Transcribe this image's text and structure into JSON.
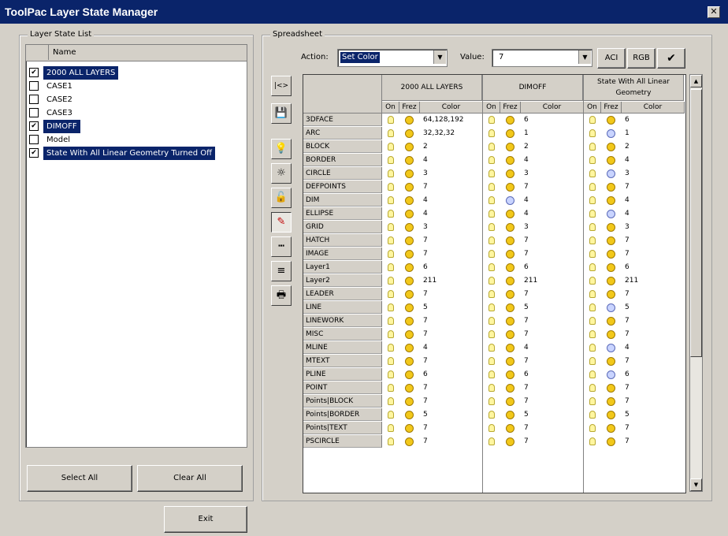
{
  "window": {
    "title": "ToolPac Layer State Manager",
    "close_glyph": "✕"
  },
  "layer_state_list": {
    "legend": "Layer State List",
    "header_name": "Name",
    "items": [
      {
        "label": "2000 ALL LAYERS",
        "checked": true,
        "selected": true
      },
      {
        "label": "CASE1",
        "checked": false,
        "selected": false
      },
      {
        "label": "CASE2",
        "checked": false,
        "selected": false
      },
      {
        "label": "CASE3",
        "checked": false,
        "selected": false
      },
      {
        "label": "DIMOFF",
        "checked": true,
        "selected": true
      },
      {
        "label": "Model",
        "checked": false,
        "selected": false
      },
      {
        "label": "State With All Linear Geometry Turned Off",
        "checked": true,
        "selected": true
      }
    ],
    "select_all_label": "Select All",
    "clear_all_label": "Clear All"
  },
  "spreadsheet": {
    "legend": "Spreadsheet",
    "action_label": "Action:",
    "action_value": "Set Color",
    "value_label": "Value:",
    "value_value": "7",
    "aci_label": "ACI",
    "rgb_label": "RGB",
    "apply_glyph": "✔",
    "states": [
      "2000 ALL LAYERS",
      "DIMOFF",
      "State With All Linear Geometry"
    ],
    "sub_headers": {
      "on": "On",
      "frz": "Frez",
      "color": "Color"
    },
    "rows": [
      {
        "name": "3DFACE",
        "c": [
          "64,128,192",
          "6",
          "6"
        ],
        "frz": [
          0,
          0,
          0
        ]
      },
      {
        "name": "ARC",
        "c": [
          "32,32,32",
          "1",
          "1"
        ],
        "frz": [
          0,
          0,
          1
        ]
      },
      {
        "name": "BLOCK",
        "c": [
          "2",
          "2",
          "2"
        ],
        "frz": [
          0,
          0,
          0
        ]
      },
      {
        "name": "BORDER",
        "c": [
          "4",
          "4",
          "4"
        ],
        "frz": [
          0,
          0,
          0
        ]
      },
      {
        "name": "CIRCLE",
        "c": [
          "3",
          "3",
          "3"
        ],
        "frz": [
          0,
          0,
          1
        ]
      },
      {
        "name": "DEFPOINTS",
        "c": [
          "7",
          "7",
          "7"
        ],
        "frz": [
          0,
          0,
          0
        ]
      },
      {
        "name": "DIM",
        "c": [
          "4",
          "4",
          "4"
        ],
        "frz": [
          0,
          1,
          0
        ]
      },
      {
        "name": "ELLIPSE",
        "c": [
          "4",
          "4",
          "4"
        ],
        "frz": [
          0,
          0,
          1
        ]
      },
      {
        "name": "GRID",
        "c": [
          "3",
          "3",
          "3"
        ],
        "frz": [
          0,
          0,
          0
        ]
      },
      {
        "name": "HATCH",
        "c": [
          "7",
          "7",
          "7"
        ],
        "frz": [
          0,
          0,
          0
        ]
      },
      {
        "name": "IMAGE",
        "c": [
          "7",
          "7",
          "7"
        ],
        "frz": [
          0,
          0,
          0
        ]
      },
      {
        "name": "Layer1",
        "c": [
          "6",
          "6",
          "6"
        ],
        "frz": [
          0,
          0,
          0
        ]
      },
      {
        "name": "Layer2",
        "c": [
          "211",
          "211",
          "211"
        ],
        "frz": [
          0,
          0,
          0
        ]
      },
      {
        "name": "LEADER",
        "c": [
          "7",
          "7",
          "7"
        ],
        "frz": [
          0,
          0,
          0
        ]
      },
      {
        "name": "LINE",
        "c": [
          "5",
          "5",
          "5"
        ],
        "frz": [
          0,
          0,
          1
        ]
      },
      {
        "name": "LINEWORK",
        "c": [
          "7",
          "7",
          "7"
        ],
        "frz": [
          0,
          0,
          0
        ]
      },
      {
        "name": "MISC",
        "c": [
          "7",
          "7",
          "7"
        ],
        "frz": [
          0,
          0,
          0
        ]
      },
      {
        "name": "MLINE",
        "c": [
          "4",
          "4",
          "4"
        ],
        "frz": [
          0,
          0,
          1
        ]
      },
      {
        "name": "MTEXT",
        "c": [
          "7",
          "7",
          "7"
        ],
        "frz": [
          0,
          0,
          0
        ]
      },
      {
        "name": "PLINE",
        "c": [
          "6",
          "6",
          "6"
        ],
        "frz": [
          0,
          0,
          1
        ]
      },
      {
        "name": "POINT",
        "c": [
          "7",
          "7",
          "7"
        ],
        "frz": [
          0,
          0,
          0
        ]
      },
      {
        "name": "Points|BLOCK",
        "c": [
          "7",
          "7",
          "7"
        ],
        "frz": [
          0,
          0,
          0
        ]
      },
      {
        "name": "Points|BORDER",
        "c": [
          "5",
          "5",
          "5"
        ],
        "frz": [
          0,
          0,
          0
        ]
      },
      {
        "name": "Points|TEXT",
        "c": [
          "7",
          "7",
          "7"
        ],
        "frz": [
          0,
          0,
          0
        ]
      },
      {
        "name": "PSCIRCLE",
        "c": [
          "7",
          "7",
          "7"
        ],
        "frz": [
          0,
          0,
          0
        ]
      }
    ],
    "toolbar": [
      {
        "name": "layer-list-toggle-icon",
        "glyph": "|<>"
      },
      {
        "name": "save-icon",
        "glyph": "💾"
      },
      {
        "name": "lightbulb-icon",
        "glyph": "💡"
      },
      {
        "name": "freeze-sun-icon",
        "glyph": "☼"
      },
      {
        "name": "lock-icon",
        "glyph": "🔓"
      },
      {
        "name": "color-pencil-icon",
        "glyph": "✎"
      },
      {
        "name": "linetype-icon",
        "glyph": "┅"
      },
      {
        "name": "lineweight-icon",
        "glyph": "≡"
      },
      {
        "name": "plot-icon",
        "glyph": "🖶"
      }
    ]
  },
  "exit_label": "Exit",
  "colors": {
    "selection": "#0a246a",
    "titlebar": "#0a246a",
    "face": "#d4d0c8"
  }
}
